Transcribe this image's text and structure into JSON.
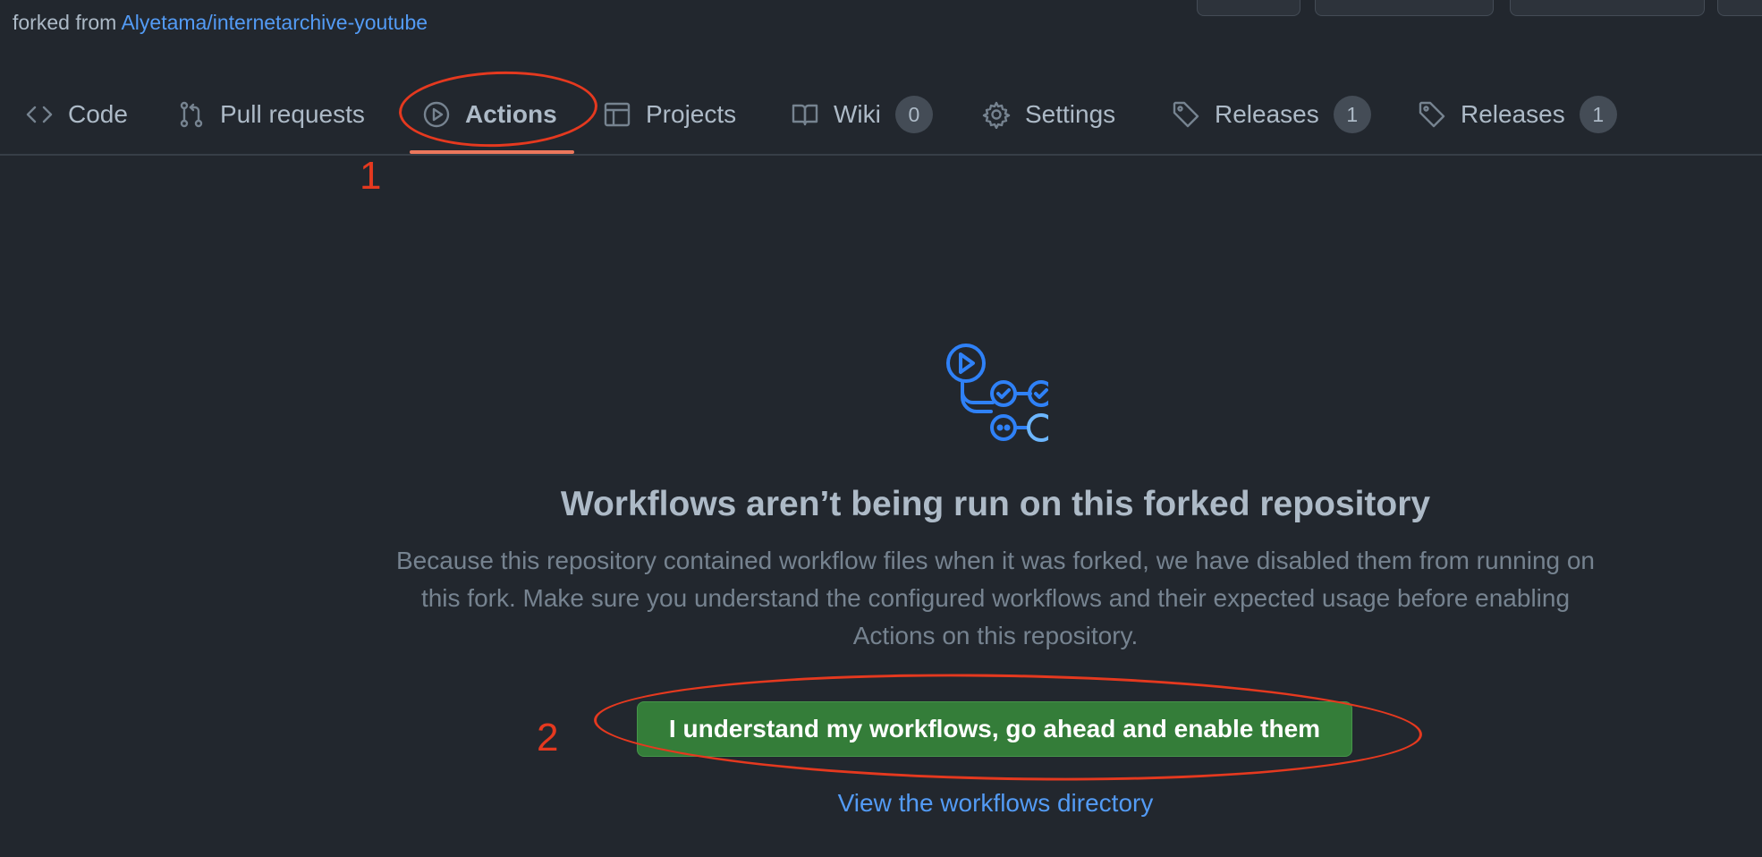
{
  "repo": {
    "forked_from_prefix": "forked from",
    "forked_from_link": "Alyetama/internetarchive-youtube"
  },
  "tabs": [
    {
      "label": "Code",
      "icon": "code-icon"
    },
    {
      "label": "Pull requests",
      "icon": "git-pull-request-icon"
    },
    {
      "label": "Actions",
      "icon": "play-icon",
      "active": true
    },
    {
      "label": "Projects",
      "icon": "table-icon"
    },
    {
      "label": "Wiki",
      "icon": "book-icon",
      "count": "0"
    },
    {
      "label": "Settings",
      "icon": "gear-icon"
    },
    {
      "label": "Releases",
      "icon": "tag-icon",
      "count": "1"
    },
    {
      "label": "Releases",
      "icon": "tag-icon",
      "count": "1"
    }
  ],
  "annotations": {
    "step1": "1",
    "step2": "2"
  },
  "blankslate": {
    "icon": "workflow-illustration-icon",
    "heading": "Workflows aren’t being run on this forked repository",
    "description": "Because this repository contained workflow files when it was forked, we have disabled them from running on this fork. Make sure you understand the configured workflows and their expected usage before enabling Actions on this repository.",
    "enable_button": "I understand my workflows, go ahead and enable them",
    "view_link": "View the workflows directory"
  },
  "colors": {
    "background": "#22272e",
    "link": "#539bf5",
    "button_green": "#347d39",
    "annotation_red": "#e5391f",
    "active_underline": "#ec775c"
  }
}
